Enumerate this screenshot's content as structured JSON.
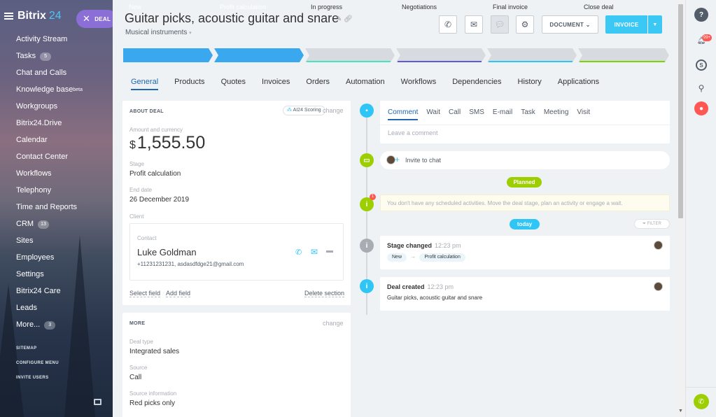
{
  "brand": {
    "name": "Bitrix",
    "num": "24"
  },
  "deal_pill": {
    "label": "DEAL"
  },
  "sidebar": {
    "items": [
      {
        "label": "Activity Stream"
      },
      {
        "label": "Tasks",
        "badge": "5"
      },
      {
        "label": "Chat and Calls"
      },
      {
        "label": "Knowledge base",
        "sup": "beta"
      },
      {
        "label": "Workgroups"
      },
      {
        "label": "Bitrix24.Drive"
      },
      {
        "label": "Calendar"
      },
      {
        "label": "Contact Center"
      },
      {
        "label": "Workflows"
      },
      {
        "label": "Telephony"
      },
      {
        "label": "Time and Reports"
      },
      {
        "label": "CRM",
        "badge": "13"
      },
      {
        "label": "Sites"
      },
      {
        "label": "Employees"
      },
      {
        "label": "Settings"
      },
      {
        "label": "Bitrix24 Care"
      },
      {
        "label": "Leads"
      },
      {
        "label": "More...",
        "badge": "3"
      }
    ],
    "small": [
      "SITEMAP",
      "CONFIGURE MENU",
      "INVITE USERS"
    ]
  },
  "header": {
    "title": "Guitar picks, acoustic guitar and snare",
    "subtitle": "Musical instruments",
    "document_label": "DOCUMENT",
    "invoice_label": "INVOICE"
  },
  "stages": [
    {
      "label": "New",
      "color": "#39a8ef",
      "active": true
    },
    {
      "label": "Profit calculation",
      "color": "#39a8ef",
      "active": true
    },
    {
      "label": "In progress",
      "color": "#d7dbe0",
      "underline": "#47e4c2"
    },
    {
      "label": "Negotiations",
      "color": "#d7dbe0",
      "underline": "#5f5bd4"
    },
    {
      "label": "Final invoice",
      "color": "#d7dbe0",
      "underline": "#2fc6f6"
    },
    {
      "label": "Close deal",
      "color": "#d7dbe0",
      "underline": "#7bd500"
    }
  ],
  "tabs": [
    "General",
    "Products",
    "Quotes",
    "Invoices",
    "Orders",
    "Automation",
    "Workflows",
    "Dependencies",
    "History",
    "Applications"
  ],
  "about": {
    "heading": "ABOUT DEAL",
    "ai_label": "AI24 Scoring",
    "change": "change",
    "amount_label": "Amount and currency",
    "currency": "$",
    "amount": "1,555.50",
    "stage_label": "Stage",
    "stage": "Profit calculation",
    "end_label": "End date",
    "end": "26 December 2019",
    "client_label": "Client",
    "contact_label": "Contact",
    "contact_name": "Luke Goldman",
    "contact_info": "+11231231231, asdasdfdge21@gmail.com",
    "select_field": "Select field",
    "add_field": "Add field",
    "delete_section": "Delete section"
  },
  "more": {
    "heading": "MORE",
    "change": "change",
    "deal_type_label": "Deal type",
    "deal_type": "Integrated sales",
    "source_label": "Source",
    "source": "Call",
    "source_info_label": "Source information",
    "source_info": "Red picks only"
  },
  "comment_tabs": [
    "Comment",
    "Wait",
    "Call",
    "SMS",
    "E-mail",
    "Task",
    "Meeting",
    "Visit"
  ],
  "comment_placeholder": "Leave a comment",
  "invite_chat": "Invite to chat",
  "planned": "Planned",
  "no_activities": "You don't have any scheduled activities. Move the deal stage, plan an activity or engage a wait.",
  "alert_count": "1",
  "today": "today",
  "filter": "FILTER",
  "events": [
    {
      "title": "Stage changed",
      "time": "12:23 pm",
      "from": "New",
      "arrow": "→",
      "to": "Profit calculation"
    },
    {
      "title": "Deal created",
      "time": "12:23 pm",
      "text": "Guitar picks, acoustic guitar and snare"
    }
  ],
  "notif_badge": "99+",
  "colors": {
    "accent": "#3bc8f5",
    "tab_active": "#2067b0",
    "planned": "#9dcf00",
    "info": "#2fc6f6",
    "gray": "#a8adb4",
    "red": "#ff5752"
  }
}
